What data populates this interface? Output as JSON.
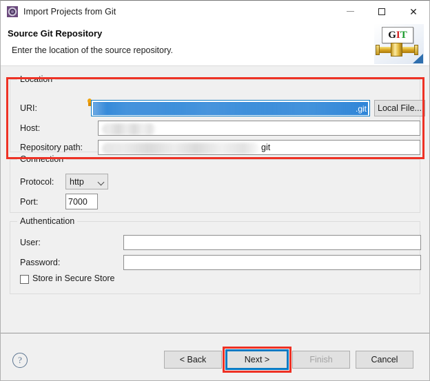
{
  "window": {
    "title": "Import Projects from Git",
    "icon": "eclipse-gear-icon",
    "controls": {
      "minimize": "minimize-icon",
      "maximize": "maximize-icon",
      "close": "close-icon"
    }
  },
  "header": {
    "title": "Source Git Repository",
    "subtitle": "Enter the location of the source repository.",
    "logo": {
      "letters": [
        "G",
        "I",
        "T"
      ],
      "colors": {
        "g": "#111111",
        "i": "#d42121",
        "t": "#1d9c2e"
      }
    }
  },
  "location": {
    "group_label": "Location",
    "uri": {
      "label": "URI:",
      "value_visible_suffix": ".git",
      "selected": true,
      "redacted": true,
      "decoration": "info-bulb-icon"
    },
    "host": {
      "label": "Host:",
      "value": "",
      "redacted": true
    },
    "repository_path": {
      "label": "Repository path:",
      "value_visible_suffix": "git",
      "redacted": true
    },
    "local_file_button": "Local File..."
  },
  "connection": {
    "group_label": "Connection",
    "protocol": {
      "label": "Protocol:",
      "selected": "http"
    },
    "port": {
      "label": "Port:",
      "value": "7000"
    }
  },
  "authentication": {
    "group_label": "Authentication",
    "user": {
      "label": "User:",
      "value": ""
    },
    "password": {
      "label": "Password:",
      "value": ""
    },
    "store_secure": {
      "label": "Store in Secure Store",
      "checked": false
    }
  },
  "footer": {
    "help": "?",
    "back": "< Back",
    "next": "Next >",
    "finish": "Finish",
    "cancel": "Cancel",
    "next_focused": true,
    "finish_disabled": true
  },
  "annotations": {
    "highlight_color": "#ee3124",
    "focus_color": "#0a7ac4",
    "regions": [
      "location-group",
      "next-button"
    ]
  }
}
